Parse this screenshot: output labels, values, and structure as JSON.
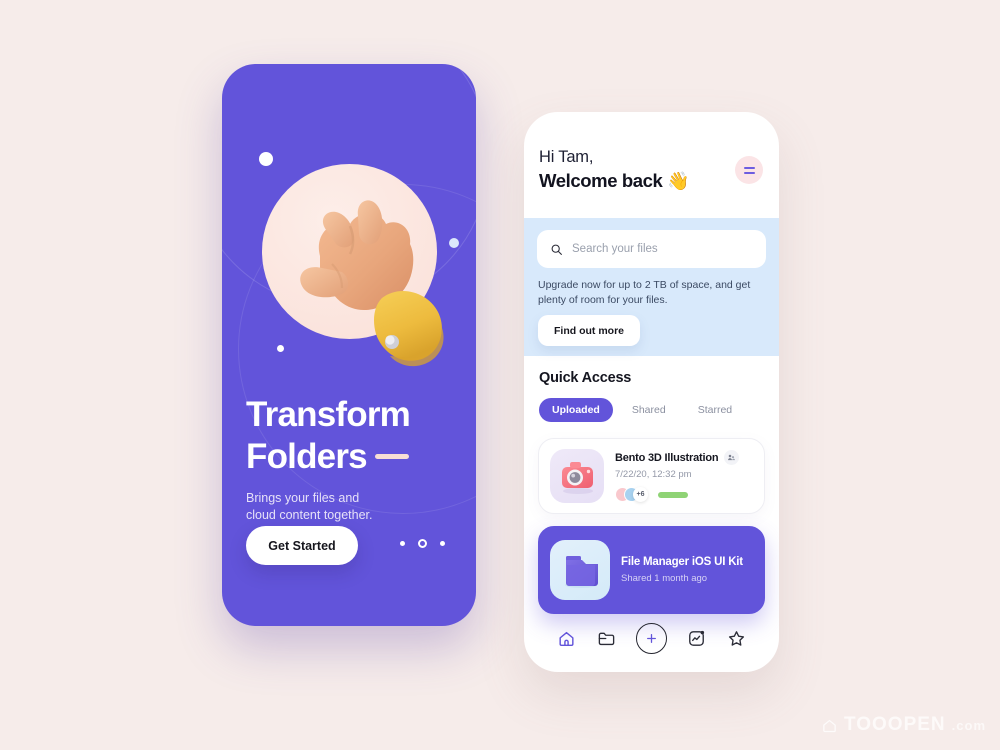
{
  "background_color": "#f6ecea",
  "watermark": {
    "brand": "TOOOPEN",
    "domain": ".com"
  },
  "onboarding": {
    "accent_color": "#6254da",
    "headline_line1": "Transform",
    "headline_line2": "Folders",
    "subcopy_line1": "Brings your files and",
    "subcopy_line2": "cloud content together.",
    "cta_label": "Get Started",
    "illustration_name": "3d-grabbing-hand",
    "pagination": {
      "total": 3,
      "current": 2
    }
  },
  "app": {
    "header": {
      "greeting": "Hi Tam,",
      "welcome": "Welcome back",
      "wave_emoji": "👋",
      "menu_icon": "hamburger-icon"
    },
    "search": {
      "placeholder": "Search your files",
      "icon": "search-icon"
    },
    "promo": {
      "background_color": "#d8e9fb",
      "text": "Upgrade now for up to 2 TB of space, and get plenty of room for your files.",
      "line1": "Upgrade now for up to 2 TB of space, and get",
      "line2": "plenty of room for your files.",
      "button_label": "Find out more"
    },
    "quick_access": {
      "title": "Quick Access",
      "tabs": [
        {
          "label": "Uploaded",
          "active": true
        },
        {
          "label": "Shared",
          "active": false
        },
        {
          "label": "Starred",
          "active": false
        }
      ],
      "files": [
        {
          "title": "Bento 3D Illustration",
          "subtitle": "7/22/20, 12:32 pm",
          "thumb_icon": "camera-3d-icon",
          "share_icon": "share-people-icon",
          "avatars_extra": "+6",
          "progress_color": "#8fd375",
          "selected": false
        },
        {
          "title": "File Manager iOS UI Kit",
          "subtitle": "Shared 1 month ago",
          "thumb_icon": "folder-3d-icon",
          "progress_color": "#f6bb9a",
          "selected": true
        }
      ]
    },
    "bottom_nav": [
      {
        "icon": "home-icon",
        "active": true
      },
      {
        "icon": "folder-icon",
        "active": false
      },
      {
        "icon": "plus-circle-icon",
        "active": false
      },
      {
        "icon": "activity-icon",
        "active": false
      },
      {
        "icon": "star-icon",
        "active": false
      }
    ]
  }
}
